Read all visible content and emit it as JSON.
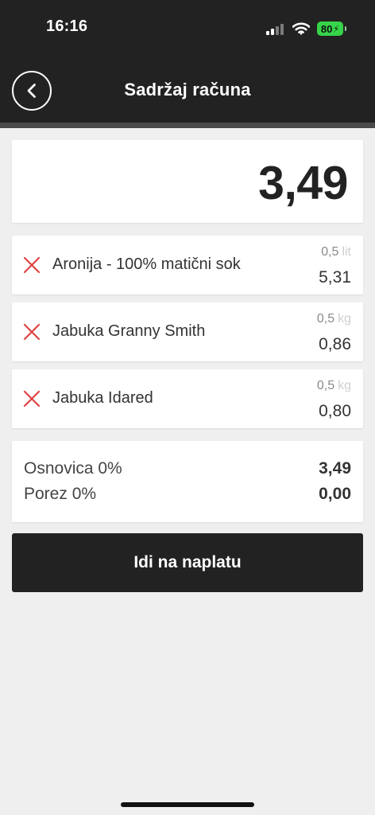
{
  "status_bar": {
    "time": "16:16",
    "battery_level": "80",
    "signal_icon": "signal-strength-icon",
    "wifi_icon": "wifi-icon",
    "battery_icon": "charging-battery-icon"
  },
  "header": {
    "title": "Sadržaj računa",
    "back_icon": "chevron-left-circle-icon"
  },
  "total": "3,49",
  "items": [
    {
      "name": "Aronija - 100% matični sok",
      "quantity": "0,5",
      "unit": "lit",
      "price": "5,31",
      "remove_icon": "close-icon"
    },
    {
      "name": "Jabuka Granny Smith",
      "quantity": "0,5",
      "unit": "kg",
      "price": "0,86",
      "remove_icon": "close-icon"
    },
    {
      "name": "Jabuka Idared",
      "quantity": "0,5",
      "unit": "kg",
      "price": "0,80",
      "remove_icon": "close-icon"
    }
  ],
  "summary": [
    {
      "label": "Osnovica 0%",
      "value": "3,49"
    },
    {
      "label": "Porez 0%",
      "value": "0,00"
    }
  ],
  "actions": {
    "pay_label": "Idi na naplatu"
  },
  "colors": {
    "header_bg": "#222222",
    "page_bg": "#efefef",
    "remove_red": "#e04343",
    "battery_green": "#37d34a",
    "muted_unit": "#cfcfcf"
  }
}
